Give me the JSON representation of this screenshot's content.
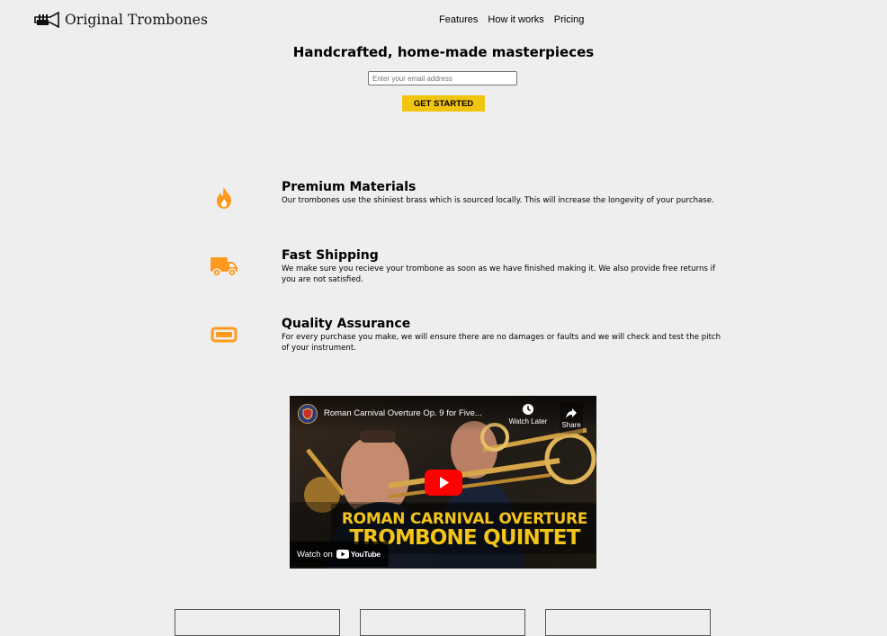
{
  "header": {
    "logo_text": "Original Trombones",
    "logo_icon": "trumpet-icon",
    "nav": [
      {
        "label": "Features"
      },
      {
        "label": "How it works"
      },
      {
        "label": "Pricing"
      }
    ]
  },
  "hero": {
    "title": "Handcrafted, home-made masterpieces",
    "email_placeholder": "Enter your email address",
    "cta_label": "GET STARTED"
  },
  "features": [
    {
      "icon": "fire-icon",
      "title": "Premium Materials",
      "description": "Our trombones use the shiniest brass which is sourced locally. This will increase the longevity of your purchase."
    },
    {
      "icon": "truck-icon",
      "title": "Fast Shipping",
      "description": "We make sure you recieve your trombone as soon as we have finished making it. We also provide free returns if you are not satisfied."
    },
    {
      "icon": "battery-icon",
      "title": "Quality Assurance",
      "description": "For every purchase you make, we will ensure there are no damages or faults and we will check and test the pitch of your instrument."
    }
  ],
  "video": {
    "title": "Roman Carnival Overture Op. 9 for Five...",
    "watch_later_label": "Watch Later",
    "share_label": "Share",
    "banner_line1": "ROMAN CARNIVAL OVERTURE",
    "banner_line2": "TROMBONE QUINTET",
    "watch_on_label": "Watch on",
    "youtube_label": "YouTube"
  },
  "colors": {
    "background": "#eeeeee",
    "accent": "#f1c40f",
    "icon_orange": "#ff9a1f"
  }
}
